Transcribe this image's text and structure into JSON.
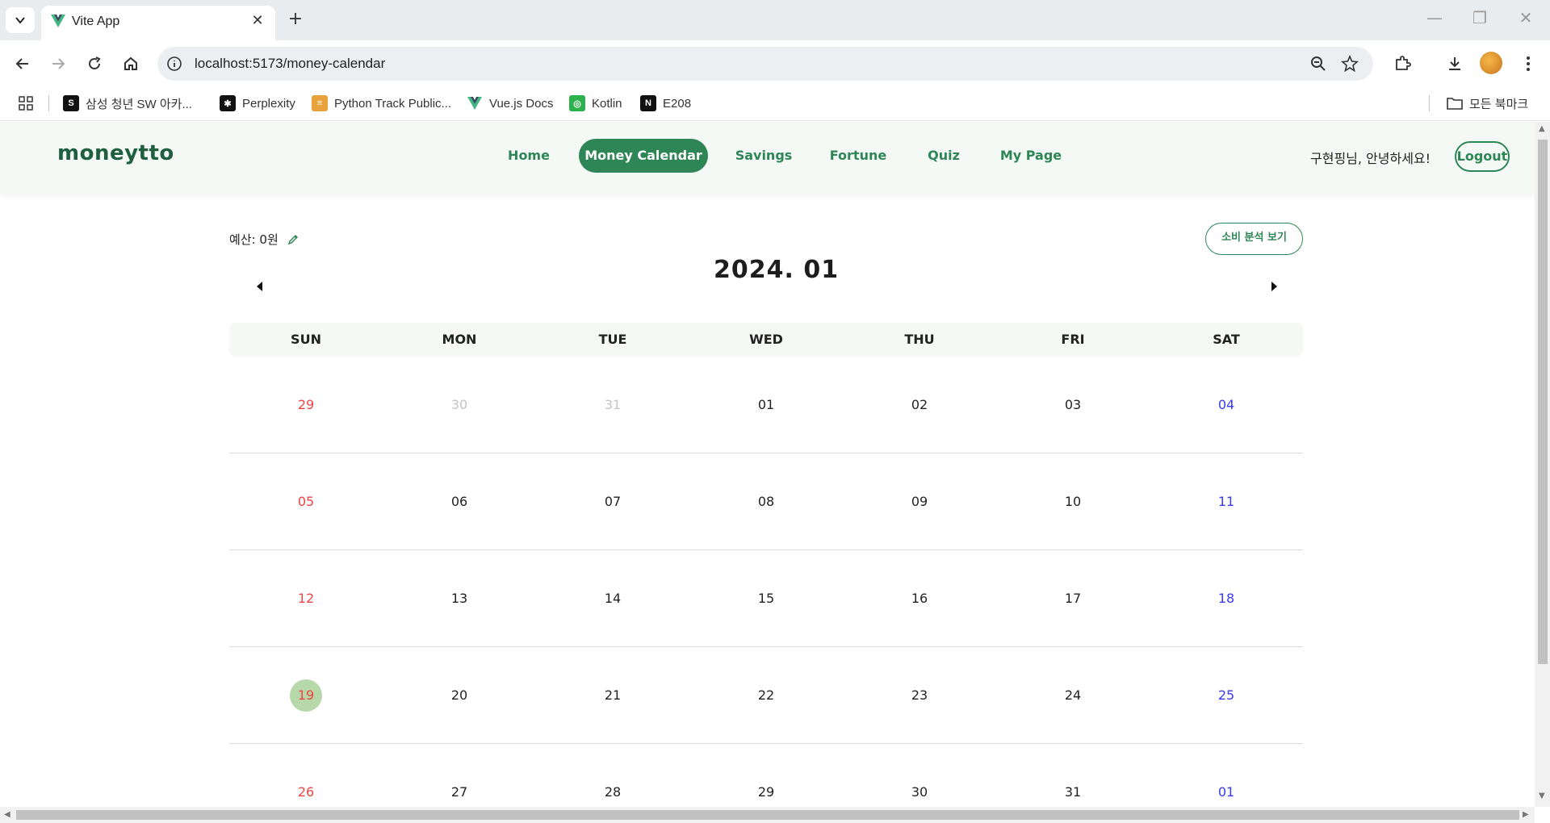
{
  "browser": {
    "tab_title": "Vite App",
    "tab_close": "✕",
    "new_tab": "+",
    "url": "localhost:5173/money-calendar",
    "window_controls": [
      "—",
      "❐",
      "✕"
    ]
  },
  "bookmarks": {
    "items": [
      {
        "label": "삼성 청년 SW 아카...",
        "icon": "samsung-icon",
        "color": "#111111"
      },
      {
        "label": "Perplexity",
        "icon": "perplexity-icon",
        "color": "#111111"
      },
      {
        "label": "Python Track Public...",
        "icon": "scroll-icon",
        "color": "#e8a33c"
      },
      {
        "label": "Vue.js Docs",
        "icon": "vue-icon",
        "color": "#41b883"
      },
      {
        "label": "Kotlin",
        "icon": "kotlin-icon",
        "color": "#2bb24c"
      },
      {
        "label": "E208",
        "icon": "notion-icon",
        "color": "#111111"
      }
    ],
    "all_bookmarks": "모든 북마크"
  },
  "app": {
    "logo": "moneytto",
    "nav": [
      {
        "label": "Home",
        "active": false
      },
      {
        "label": "Money Calendar",
        "active": true
      },
      {
        "label": "Savings",
        "active": false
      },
      {
        "label": "Fortune",
        "active": false
      },
      {
        "label": "Quiz",
        "active": false
      },
      {
        "label": "My Page",
        "active": false
      }
    ],
    "greeting": "구현핑님, 안녕하세요!",
    "logout": "Logout",
    "accent": "#2e8555"
  },
  "calendar": {
    "budget_label": "예산: 0원",
    "analysis_button": "소비 분석 보기",
    "month_title": "2024. 01",
    "weekdays": [
      "SUN",
      "MON",
      "TUE",
      "WED",
      "THU",
      "FRI",
      "SAT"
    ],
    "today": "19",
    "weeks": [
      [
        "29",
        "30",
        "31",
        "01",
        "02",
        "03",
        "04"
      ],
      [
        "05",
        "06",
        "07",
        "08",
        "09",
        "10",
        "11"
      ],
      [
        "12",
        "13",
        "14",
        "15",
        "16",
        "17",
        "18"
      ],
      [
        "19",
        "20",
        "21",
        "22",
        "23",
        "24",
        "25"
      ],
      [
        "26",
        "27",
        "28",
        "29",
        "30",
        "31",
        "01"
      ]
    ],
    "other_month": [
      [
        1,
        2
      ]
    ],
    "colors": {
      "sunday": "#ee4444",
      "saturday": "#3a3af0",
      "other_month": "#c4c4c4",
      "today_bg": "#b7d8a8"
    }
  }
}
